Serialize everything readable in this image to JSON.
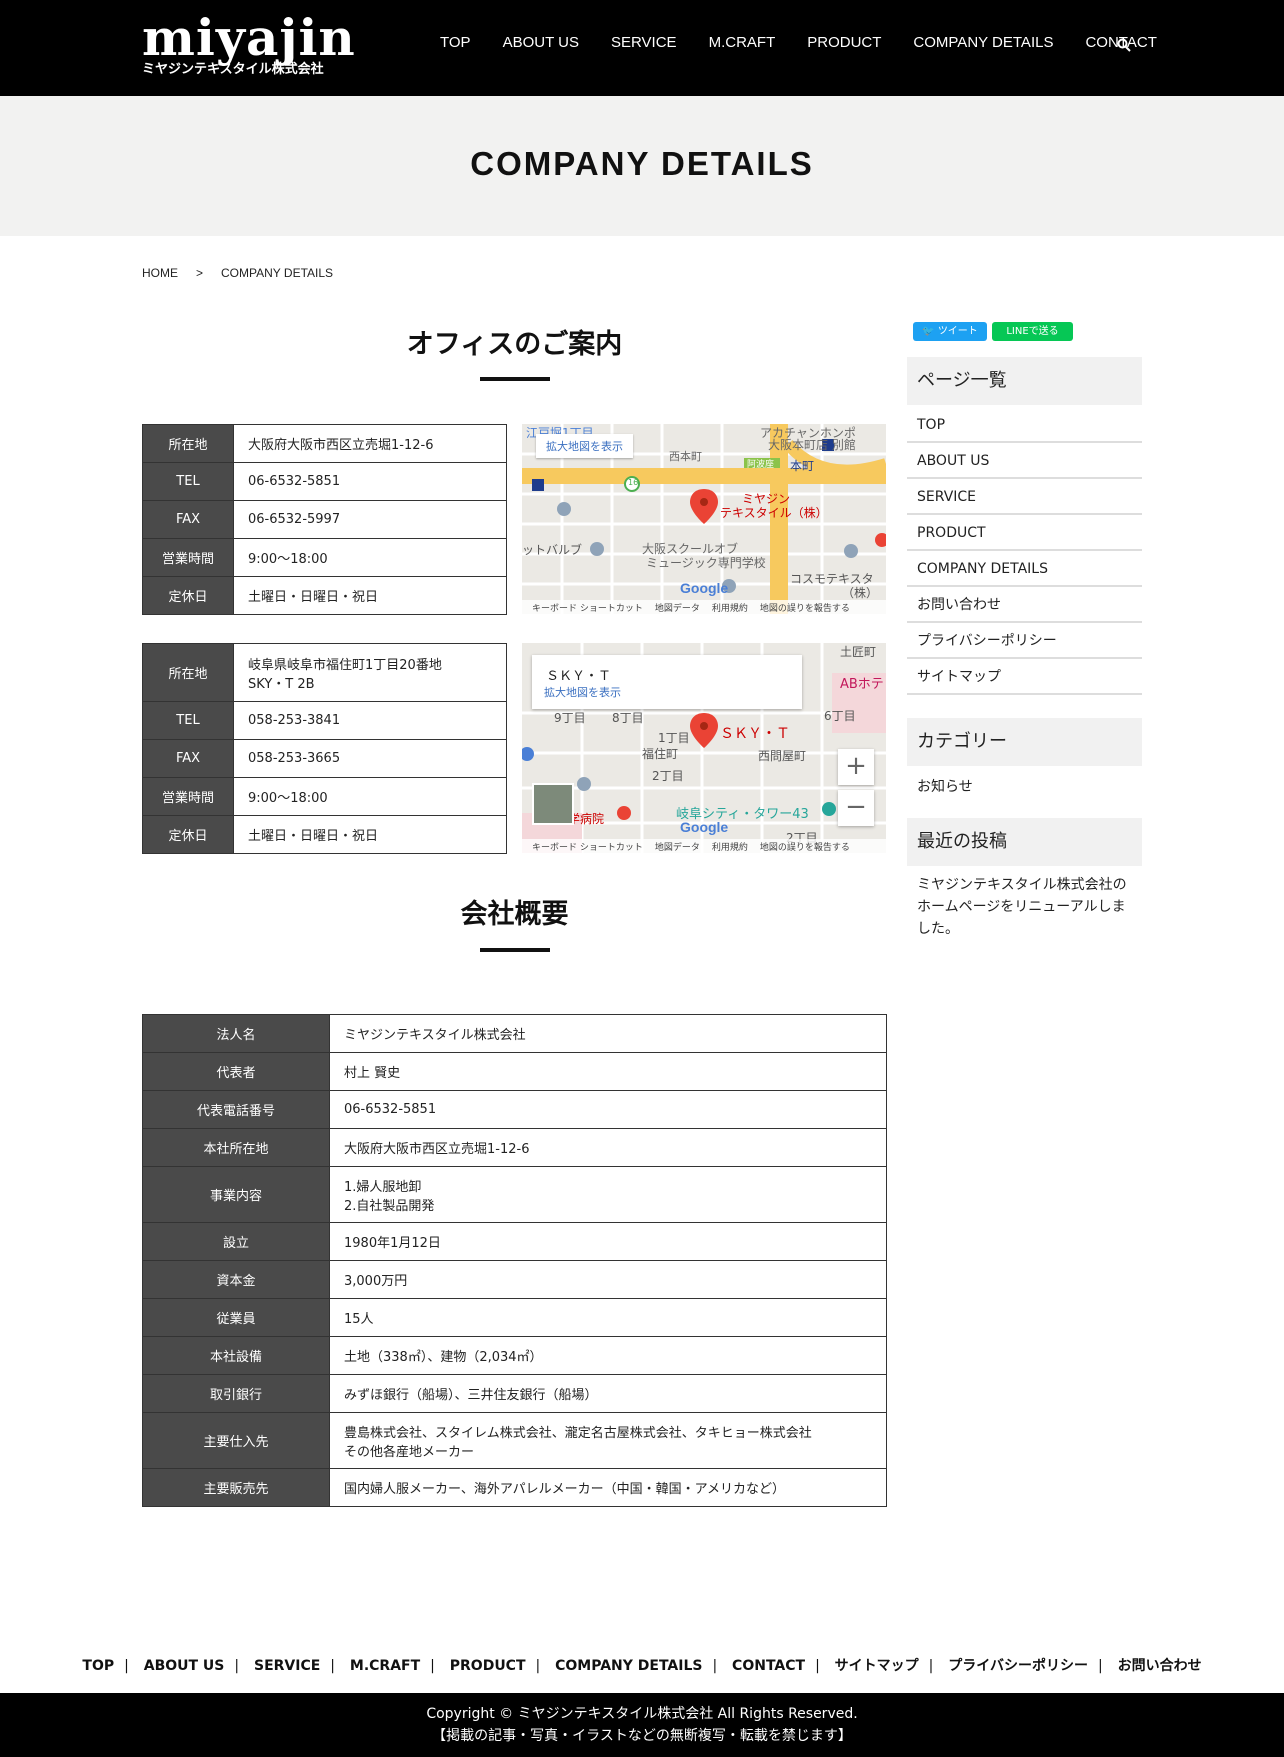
{
  "header": {
    "logo_main": "miyajin",
    "logo_sub": "ミヤジンテキスタイル株式会社",
    "nav": [
      "TOP",
      "ABOUT US",
      "SERVICE",
      "M.CRAFT",
      "PRODUCT",
      "COMPANY DETAILS",
      "CONTACT"
    ]
  },
  "page_title": "COMPANY DETAILS",
  "breadcrumb": {
    "home": "HOME",
    "sep": ">",
    "current": "COMPANY DETAILS"
  },
  "offices_heading": "オフィスのご案内",
  "office1": {
    "rows": [
      {
        "th": "所在地",
        "td": "大阪府大阪市西区立売堀1-12-6"
      },
      {
        "th": "TEL",
        "td": "06-6532-5851"
      },
      {
        "th": "FAX",
        "td": "06-6532-5997"
      },
      {
        "th": "営業時間",
        "td": "9:00〜18:00"
      },
      {
        "th": "定休日",
        "td": "土曜日・日曜日・祝日"
      }
    ],
    "map": {
      "link": "拡大地図を表示",
      "pin_label_1": "ミヤジン",
      "pin_label_2": "テキスタイル（株）",
      "labels": [
        "西本町",
        "アカチャンホンポ",
        "大阪本町店 別館",
        "阿波座",
        "本町",
        "ットバルブ",
        "大阪スクールオブ",
        "ミュージック専門学校",
        "コスモテキスタ",
        "（株）",
        "江戸堀1丁目"
      ],
      "road_number": "16",
      "footer": [
        "キーボード ショートカット",
        "地図データ",
        "利用規約",
        "地図の誤りを報告する"
      ]
    }
  },
  "office2": {
    "rows": [
      {
        "th": "所在地",
        "td1": "岐阜県岐阜市福住町1丁目20番地",
        "td2": "SKY・T 2B"
      },
      {
        "th": "TEL",
        "td": "058-253-3841"
      },
      {
        "th": "FAX",
        "td": "058-253-3665"
      },
      {
        "th": "営業時間",
        "td": "9:00〜18:00"
      },
      {
        "th": "定休日",
        "td": "土曜日・日曜日・祝日"
      }
    ],
    "map": {
      "place": "ＳＫＹ・Ｔ",
      "link": "拡大地図を表示",
      "pin_label": "ＳＫＹ・Ｔ",
      "labels": [
        "1丁目",
        "福住町",
        "西問屋町",
        "2丁目",
        "岐阜シティ・タワー43",
        "9丁目",
        "8丁目",
        "6丁目",
        "ABホテ",
        "学病院",
        "土匠町",
        "2丁目"
      ],
      "footer": [
        "キーボード ショートカット",
        "地図データ",
        "利用規約",
        "地図の誤りを報告する"
      ]
    }
  },
  "company_heading": "会社概要",
  "company": [
    {
      "th": "法人名",
      "lines": [
        "ミヤジンテキスタイル株式会社"
      ]
    },
    {
      "th": "代表者",
      "lines": [
        "村上 賢史"
      ]
    },
    {
      "th": "代表電話番号",
      "lines": [
        "06-6532-5851"
      ]
    },
    {
      "th": "本社所在地",
      "lines": [
        "大阪府大阪市西区立売堀1-12-6"
      ]
    },
    {
      "th": "事業内容",
      "lines": [
        "1.婦人服地卸",
        "2.自社製品開発"
      ]
    },
    {
      "th": "設立",
      "lines": [
        "1980年1月12日"
      ]
    },
    {
      "th": "資本金",
      "lines": [
        "3,000万円"
      ]
    },
    {
      "th": "従業員",
      "lines": [
        "15人"
      ]
    },
    {
      "th": "本社設備",
      "lines": [
        "土地（338㎡）、建物（2,034㎡）"
      ]
    },
    {
      "th": "取引銀行",
      "lines": [
        "みずほ銀行（船場）、三井住友銀行（船場）"
      ]
    },
    {
      "th": "主要仕入先",
      "lines": [
        "豊島株式会社、スタイレム株式会社、瀧定名古屋株式会社、タキヒョー株式会社",
        "その他各産地メーカー"
      ]
    },
    {
      "th": "主要販売先",
      "lines": [
        "国内婦人服メーカー、海外アパレルメーカー（中国・韓国・アメリカなど）"
      ]
    }
  ],
  "sidebar": {
    "tweet": "ツイート",
    "line": "LINEで送る",
    "pages_heading": "ページ一覧",
    "pages": [
      "TOP",
      "ABOUT US",
      "SERVICE",
      "PRODUCT",
      "COMPANY DETAILS",
      "お問い合わせ",
      "プライバシーポリシー",
      "サイトマップ"
    ],
    "category_heading": "カテゴリー",
    "category": "お知らせ",
    "recent_heading": "最近の投稿",
    "recent_post": "ミヤジンテキスタイル株式会社のホームページをリニューアルしました。"
  },
  "footer": {
    "nav": [
      "TOP",
      "ABOUT US",
      "SERVICE",
      "M.CRAFT",
      "PRODUCT",
      "COMPANY DETAILS",
      "CONTACT",
      "サイトマップ",
      "プライバシーポリシー",
      "お問い合わせ"
    ],
    "sep": "|",
    "copyright": "Copyright © ミヤジンテキスタイル株式会社 All Rights Reserved.",
    "notice": "【掲載の記事・写真・イラストなどの無断複写・転載を禁じます】"
  },
  "colors": {
    "header_bg": "#000000",
    "title_band_bg": "#f2f2f1",
    "table_head_bg": "#4a4a4a",
    "pin": "#ea4335",
    "tweet": "#1da1f2",
    "line": "#06c755"
  }
}
